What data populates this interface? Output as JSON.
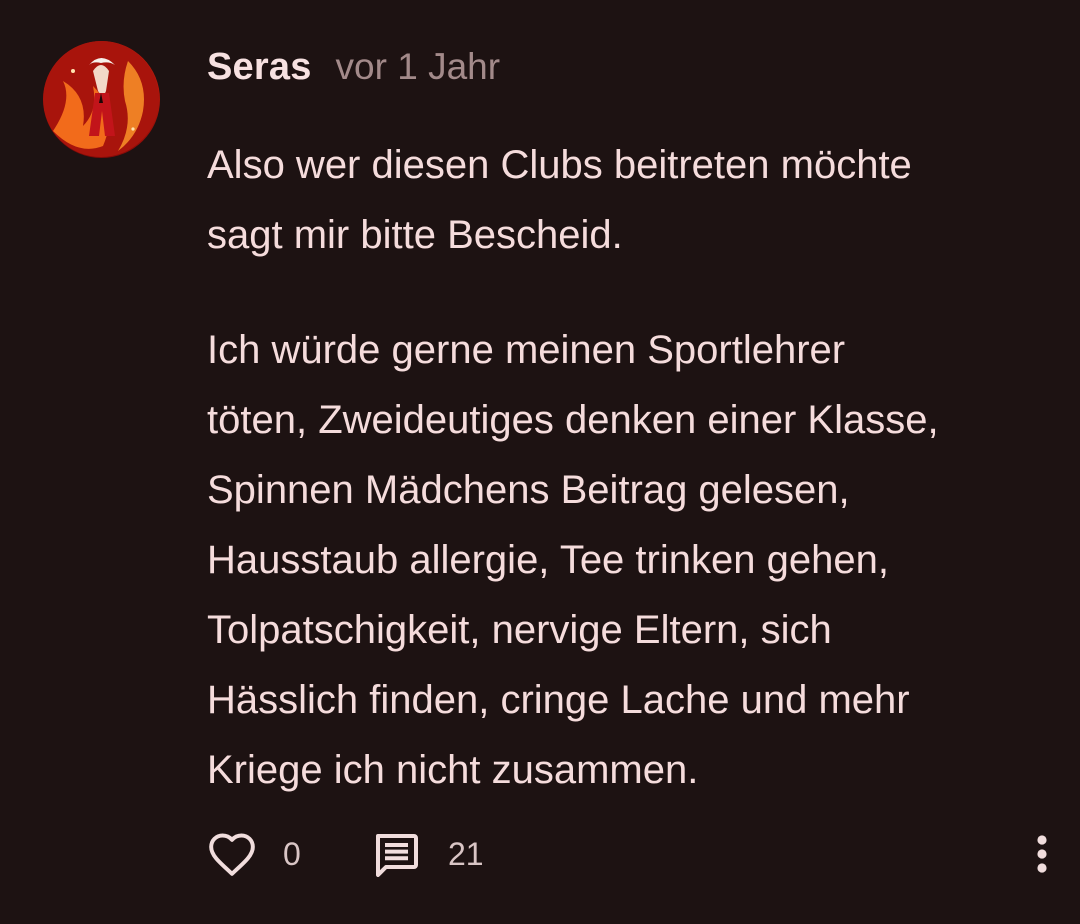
{
  "comment": {
    "author": "Seras",
    "timestamp": "vor 1 Jahr",
    "paragraphs": [
      {
        "lines": [
          "Also wer diesen Clubs beitreten möchte",
          "sagt mir bitte Bescheid."
        ]
      },
      {
        "lines": [
          "Ich würde gerne meinen Sportlehrer",
          "töten, Zweideutiges denken einer Klasse,",
          "Spinnen Mädchens Beitrag gelesen,",
          "Hausstaub allergie, Tee trinken gehen,",
          "Tolpatschigkeit, nervige Eltern, sich",
          "Hässlich finden, cringe Lache und mehr",
          "Kriege ich nicht zusammen."
        ]
      }
    ],
    "likes": "0",
    "replies": "21",
    "icons": {
      "like": "heart-outline-icon",
      "replies": "comment-icon",
      "more": "more-vertical-icon"
    }
  },
  "colors": {
    "background": "#1d1212",
    "text": "#f5dcdc",
    "muted": "#a38a8a"
  }
}
